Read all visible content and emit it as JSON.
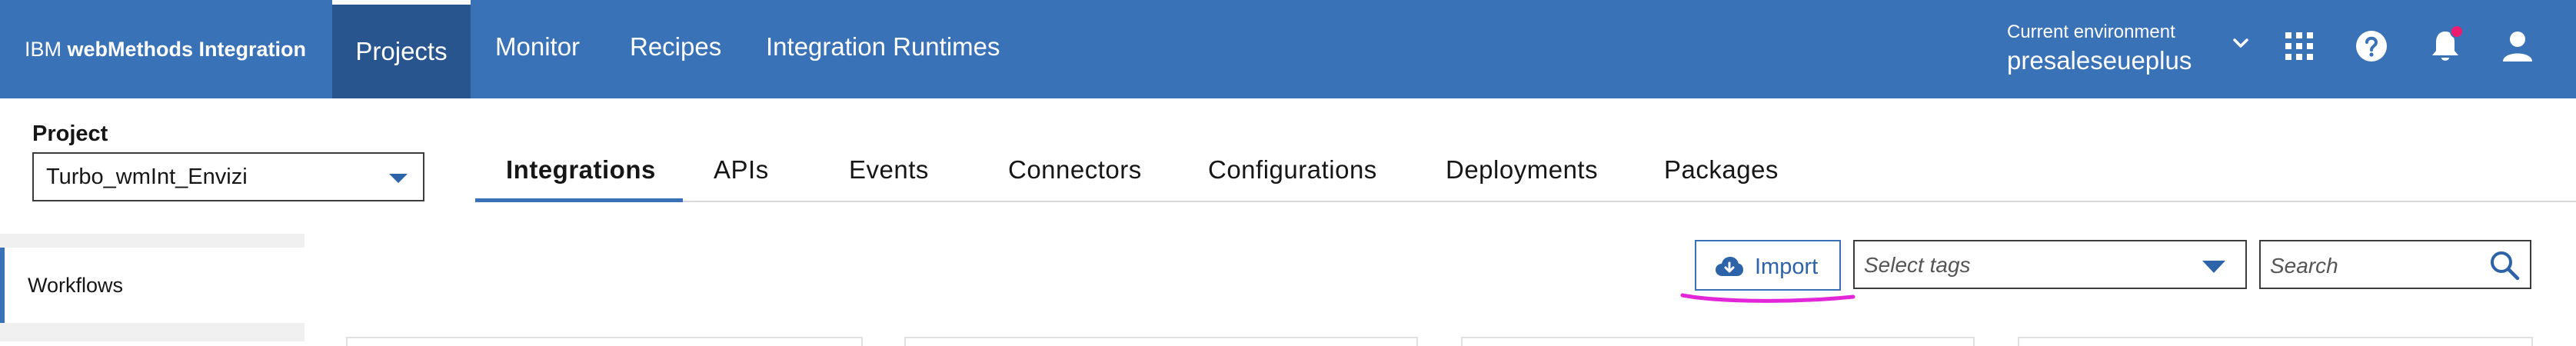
{
  "app": {
    "brand_prefix": "IBM",
    "brand_name": "webMethods Integration"
  },
  "nav": {
    "items": [
      {
        "label": "Projects",
        "active": true
      },
      {
        "label": "Monitor",
        "active": false
      },
      {
        "label": "Recipes",
        "active": false
      },
      {
        "label": "Integration Runtimes",
        "active": false
      }
    ]
  },
  "environment": {
    "label": "Current environment",
    "value": "presaleseueplus"
  },
  "header_icons": [
    "apps-grid-icon",
    "help-icon",
    "notification-bell-icon",
    "user-avatar-icon"
  ],
  "notification": {
    "has_unread": true,
    "dot_color": "#ee1c6f"
  },
  "project": {
    "label": "Project",
    "selected": "Turbo_wmInt_Envizi"
  },
  "tabs": [
    {
      "label": "Integrations",
      "active": true
    },
    {
      "label": "APIs",
      "active": false
    },
    {
      "label": "Events",
      "active": false
    },
    {
      "label": "Connectors",
      "active": false
    },
    {
      "label": "Configurations",
      "active": false
    },
    {
      "label": "Deployments",
      "active": false
    },
    {
      "label": "Packages",
      "active": false
    }
  ],
  "sidebar": {
    "items": [
      {
        "label": "Workflows",
        "active": true
      }
    ]
  },
  "toolbar": {
    "import_label": "Import",
    "tags_placeholder": "Select tags",
    "search_placeholder": "Search"
  },
  "colors": {
    "header_bg": "#3a72b8",
    "active_nav_bg": "#28558e",
    "accent": "#3a72b8",
    "annotation": "#e327d8"
  }
}
